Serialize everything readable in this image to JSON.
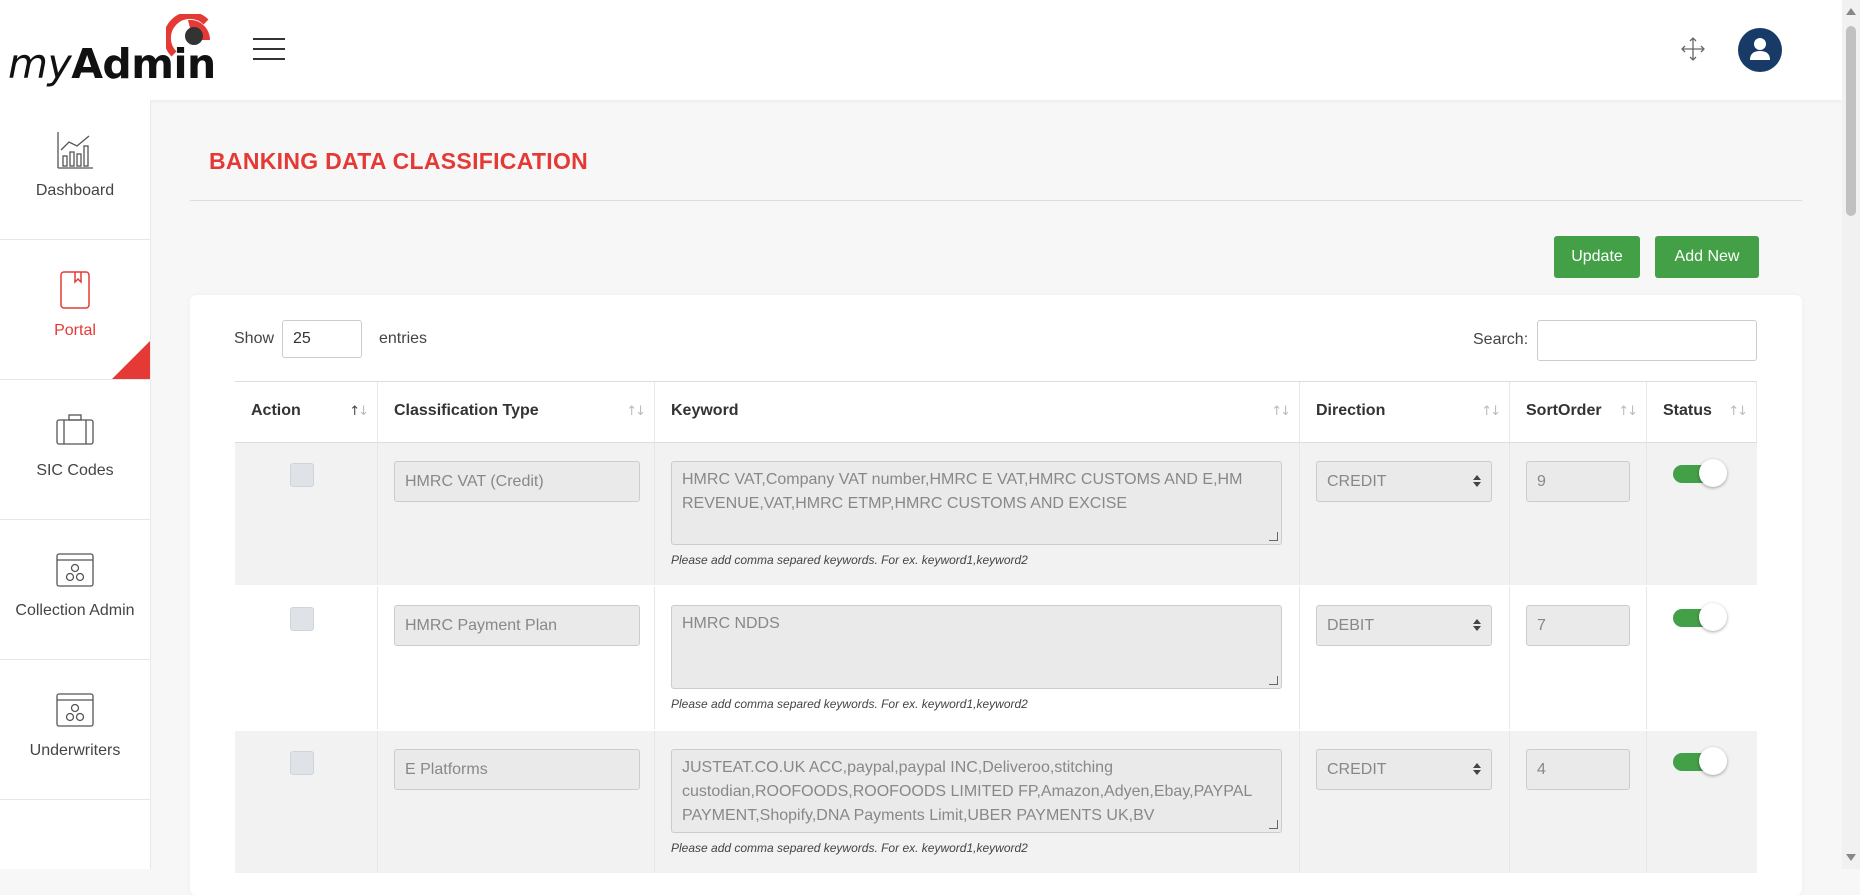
{
  "header": {
    "logo_my": "my",
    "logo_admin": "Admin"
  },
  "sidebar": {
    "items": [
      {
        "label": "Dashboard"
      },
      {
        "label": "Portal"
      },
      {
        "label": "SIC Codes"
      },
      {
        "label": "Collection Admin"
      },
      {
        "label": "Underwriters"
      }
    ]
  },
  "page": {
    "title": "BANKING DATA CLASSIFICATION",
    "update_label": "Update",
    "add_new_label": "Add New"
  },
  "table_controls": {
    "show_label": "Show",
    "page_length": "25",
    "entries_label": "entries",
    "search_label": "Search:"
  },
  "table": {
    "columns": [
      "Action",
      "Classification Type",
      "Keyword",
      "Direction",
      "SortOrder",
      "Status"
    ],
    "hint": "Please add comma separed keywords. For ex. keyword1,keyword2",
    "rows": [
      {
        "classification_type": "HMRC VAT (Credit)",
        "keyword": "HMRC VAT,Company VAT number,HMRC E VAT,HMRC CUSTOMS AND E,HM REVENUE,VAT,HMRC ETMP,HMRC CUSTOMS AND EXCISE",
        "direction": "CREDIT",
        "sort_order": "9",
        "status_on": true
      },
      {
        "classification_type": "HMRC Payment Plan",
        "keyword": "HMRC NDDS",
        "direction": "DEBIT",
        "sort_order": "7",
        "status_on": true
      },
      {
        "classification_type": "E Platforms",
        "keyword": "JUSTEAT.CO.UK ACC,paypal,paypal INC,Deliveroo,stitching custodian,ROOFOODS,ROOFOODS LIMITED FP,Amazon,Adyen,Ebay,PAYPAL PAYMENT,Shopify,DNA Payments Limit,UBER PAYMENTS UK,BV",
        "direction": "CREDIT",
        "sort_order": "4",
        "status_on": true
      }
    ]
  },
  "colors": {
    "accent_red": "#e53935",
    "button_green": "#43a047",
    "avatar_navy": "#173b66"
  },
  "icons": [
    "hamburger-icon",
    "expand-icon",
    "user-icon",
    "chart-icon",
    "book-icon",
    "briefcase-icon",
    "window-gears-icon"
  ]
}
